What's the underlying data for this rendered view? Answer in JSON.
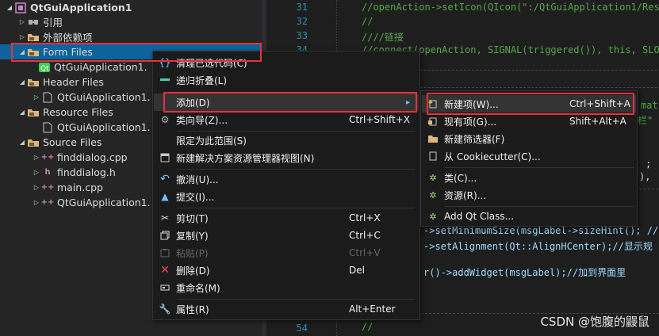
{
  "explorer": {
    "items": [
      {
        "label": "QtGuiApplication1",
        "arrow": "◢",
        "icon": "project-icon"
      },
      {
        "label": "引用",
        "arrow": "▷",
        "icon": "references-icon"
      },
      {
        "label": "外部依赖项",
        "arrow": "▷",
        "icon": "folder-icon"
      },
      {
        "label": "Form Files",
        "arrow": "◢",
        "icon": "folder-icon"
      },
      {
        "label": "QtGuiApplication1.",
        "arrow": "",
        "icon": "qt-form-icon"
      },
      {
        "label": "Header Files",
        "arrow": "◢",
        "icon": "folder-icon"
      },
      {
        "label": "QtGuiApplication1.",
        "arrow": "▷",
        "icon": "header-file-icon"
      },
      {
        "label": "Resource Files",
        "arrow": "◢",
        "icon": "folder-icon"
      },
      {
        "label": "QtGuiApplication1.",
        "arrow": "",
        "icon": "resource-file-icon"
      },
      {
        "label": "Source Files",
        "arrow": "◢",
        "icon": "folder-icon"
      },
      {
        "label": "finddialog.cpp",
        "arrow": "▷",
        "icon": "cpp-file-icon"
      },
      {
        "label": "finddialog.h",
        "arrow": "▷",
        "icon": "header-file-icon"
      },
      {
        "label": "main.cpp",
        "arrow": "▷",
        "icon": "cpp-file-icon"
      },
      {
        "label": "QtGuiApplication1.",
        "arrow": "▷",
        "icon": "cpp-file-icon"
      }
    ]
  },
  "editor": {
    "lines": [
      {
        "num": "31",
        "text": "//openAction->setIcon(QIcon(\":/QtGuiApplication1/Res"
      },
      {
        "num": "32",
        "text": "//"
      },
      {
        "num": "33",
        "text": "////链接"
      },
      {
        "num": "34",
        "text": "//connect(openAction, SIGNAL(triggered()), this, SLO"
      }
    ],
    "fragments": {
      "frag1": "mat",
      "frag2": "栏\"",
      "frag3": ";",
      "frag4": "),",
      "frag5": "->setMinimumSize(msgLabel->sizeHint(); //",
      "frag6": "->setAlignment(Qt::AlignHCenter);//显示规",
      "frag7": "r()->addWidget(msgLabel);//加到界面里"
    },
    "bottom_line": {
      "num": "54",
      "text": "//"
    }
  },
  "context_menu": {
    "items": [
      {
        "label": "清理已选代码(C)",
        "shortcut": "",
        "icon": "cleanup-icon"
      },
      {
        "label": "递归折叠(L)",
        "shortcut": "",
        "icon": "collapse-icon"
      },
      {
        "label": "添加(D)",
        "shortcut": "",
        "icon": ""
      },
      {
        "label": "类向导(Z)...",
        "shortcut": "Ctrl+Shift+X",
        "icon": "class-wizard-icon"
      },
      {
        "label": "限定为此范围(S)",
        "shortcut": "",
        "icon": ""
      },
      {
        "label": "新建解决方案资源管理器视图(N)",
        "shortcut": "",
        "icon": "new-view-icon"
      },
      {
        "label": "撤消(U)...",
        "shortcut": "",
        "icon": "undo-icon"
      },
      {
        "label": "提交(I)...",
        "shortcut": "",
        "icon": "commit-icon"
      },
      {
        "label": "剪切(T)",
        "shortcut": "Ctrl+X",
        "icon": "scissors-icon"
      },
      {
        "label": "复制(Y)",
        "shortcut": "Ctrl+C",
        "icon": "copy-icon"
      },
      {
        "label": "粘贴(P)",
        "shortcut": "Ctrl+V",
        "icon": "paste-icon"
      },
      {
        "label": "删除(D)",
        "shortcut": "Del",
        "icon": "delete-icon"
      },
      {
        "label": "重命名(M)",
        "shortcut": "",
        "icon": "rename-icon"
      },
      {
        "label": "属性(R)",
        "shortcut": "Alt+Enter",
        "icon": "wrench-icon"
      }
    ],
    "submenu_arrow": "▸"
  },
  "submenu": {
    "items": [
      {
        "label": "新建项(W)...",
        "shortcut": "Ctrl+Shift+A",
        "icon": "new-item-icon"
      },
      {
        "label": "现有项(G)...",
        "shortcut": "Shift+Alt+A",
        "icon": "existing-item-icon"
      },
      {
        "label": "新建筛选器(F)",
        "shortcut": "",
        "icon": "new-filter-icon"
      },
      {
        "label": "从 Cookiecutter(C)...",
        "shortcut": "",
        "icon": "cookiecutter-icon"
      },
      {
        "label": "类(C)...",
        "shortcut": "",
        "icon": "class-icon"
      },
      {
        "label": "资源(R)...",
        "shortcut": "",
        "icon": "resource-icon"
      },
      {
        "label": "Add Qt Class...",
        "shortcut": "",
        "icon": "qt-class-icon"
      }
    ]
  },
  "watermark": "CSDN @饱腹的鼹鼠"
}
